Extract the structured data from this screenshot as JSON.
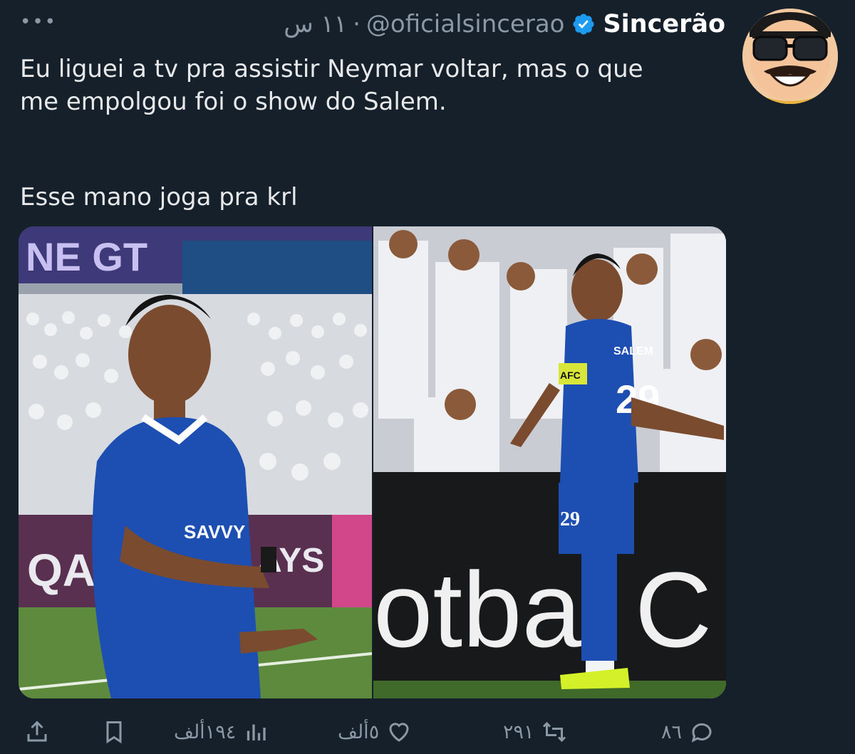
{
  "header": {
    "more_label": "•••",
    "timestamp": "١١ س",
    "separator": "·",
    "handle": "@oficialsincerao",
    "display_name": "Sincerão"
  },
  "tweet": {
    "line1": "Eu liguei a tv pra assistir Neymar voltar, mas o que",
    "line2": "me empolgou foi o show do Salem.",
    "line3": "Esse mano joga pra krl"
  },
  "media": {
    "left_banner": "NE GT",
    "left_board_1": "QAT",
    "left_board_2": "AYS",
    "left_shirt_sponsor": "SAVVY",
    "right_board": "otbal C",
    "right_back_name": "SALEM",
    "right_back_number": "29",
    "right_shorts_number": "29",
    "armband": "AFC"
  },
  "actions": {
    "reply_count": "٨٦",
    "retweet_count": "٢٩١",
    "like_count": "٥ألف",
    "views_count": "١٩٤ألف"
  },
  "colors": {
    "background": "#15202b",
    "text_primary": "#e7e9ea",
    "text_secondary": "#8b98a5",
    "verified_blue": "#1d9bf0",
    "jersey_blue": "#1d4fb3"
  },
  "icons": [
    "more-icon",
    "verified-icon",
    "avatar",
    "share-icon",
    "bookmark-icon",
    "views-icon",
    "like-icon",
    "retweet-icon",
    "reply-icon"
  ]
}
